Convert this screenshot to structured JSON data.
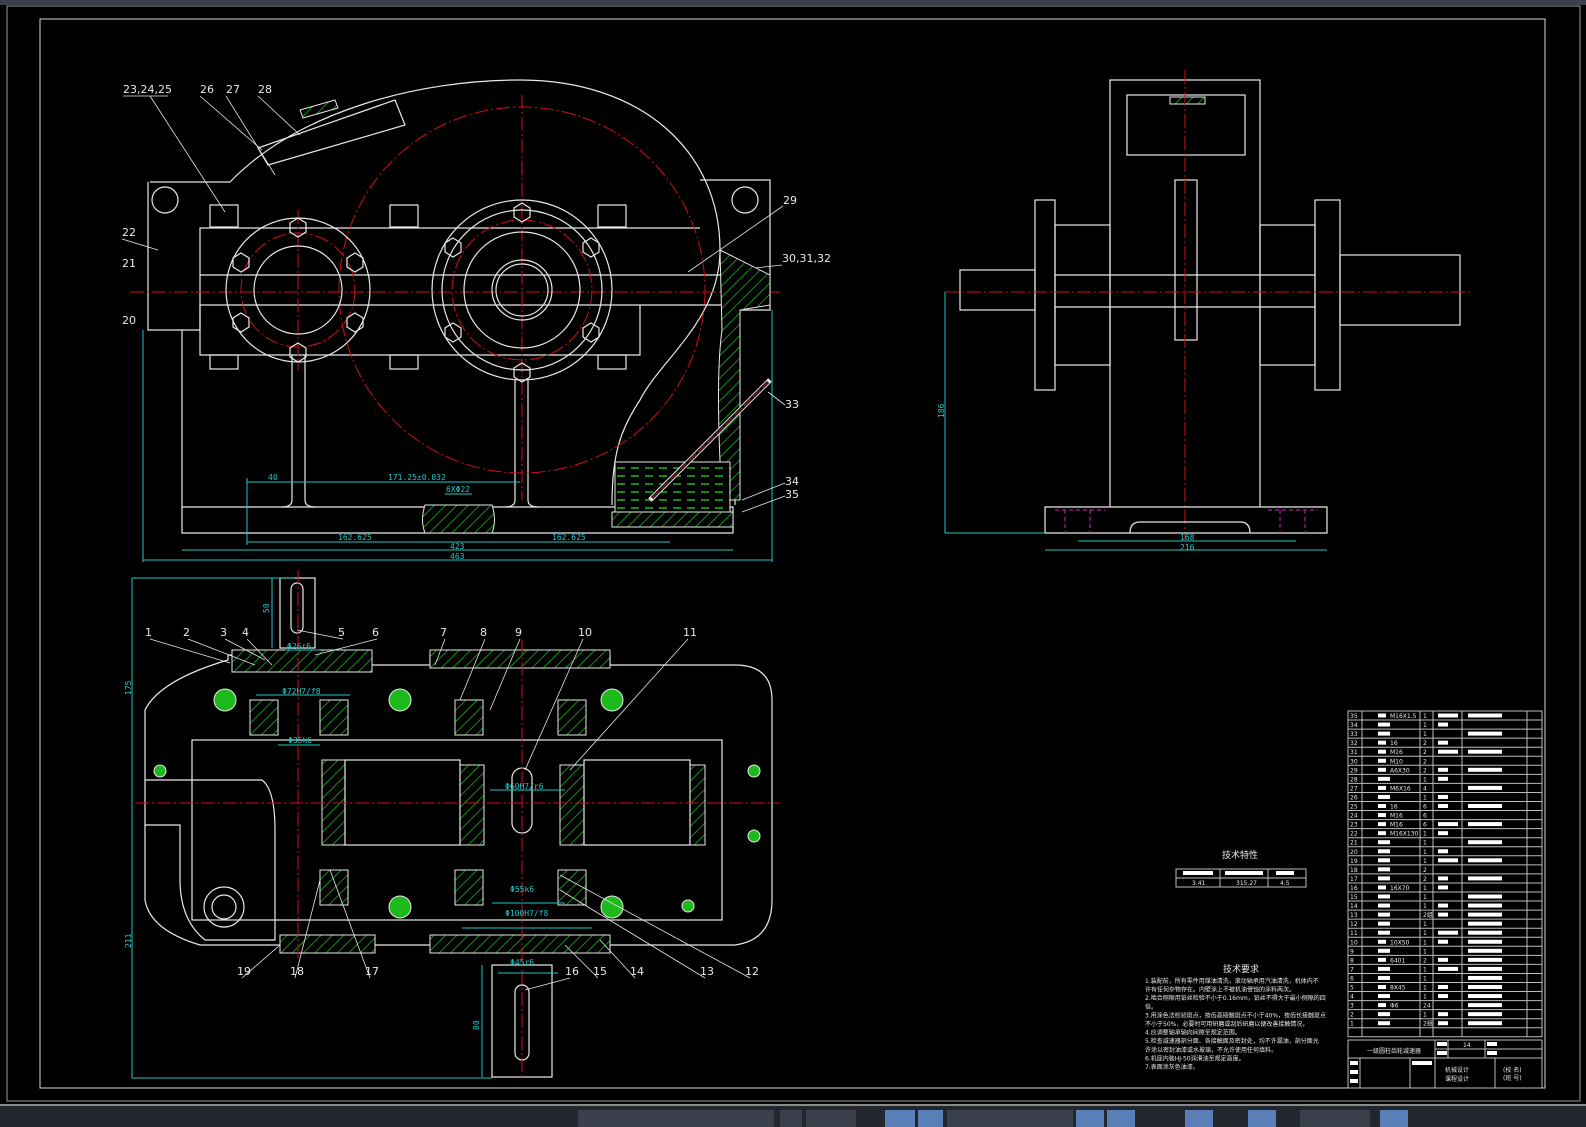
{
  "colors": {
    "background": "#000000",
    "outline": "#e8e8e8",
    "centerline": "#d01010",
    "dimension": "#1fc6c6",
    "hatch": "#1db91d",
    "hidden": "#d020d0"
  },
  "front_view": {
    "balloons": [
      "23,24,25",
      "26",
      "27",
      "28",
      "29",
      "30,31,32",
      "22",
      "21",
      "20",
      "33",
      "34",
      "35"
    ],
    "dims": {
      "d40": "40",
      "center_distance": "171.25±0.032",
      "bolt_holes": "6XΦ22",
      "half_left": "162.625",
      "half_right": "162.625",
      "inner_len": "423",
      "overall_len": "463"
    }
  },
  "side_view": {
    "dims": {
      "height": "186",
      "bolt_span": "168",
      "width": "216"
    }
  },
  "plan_view": {
    "balloons": [
      "1",
      "2",
      "3",
      "4",
      "5",
      "6",
      "7",
      "8",
      "9",
      "10",
      "11",
      "12",
      "13",
      "14",
      "15",
      "16",
      "17",
      "18",
      "19"
    ],
    "dims": {
      "key_len_in": "50",
      "shaft_in": "Φ26r6",
      "bore_in": "Φ72H7/f8",
      "bearing_in": "Φ35k6",
      "ext_top": "175",
      "gear_fit": "Φ60H7/r6",
      "bearing_out": "Φ55k6",
      "bore_out": "Φ100H7/f8",
      "shaft_out": "Φ45r6",
      "ext_bottom": "211",
      "key_len_out": "80"
    }
  },
  "tech_spec": {
    "title": "技术特性",
    "values": [
      "3.41",
      "315.27",
      "4.5"
    ]
  },
  "tech_req": {
    "title": "技术要求",
    "items": [
      "1.装配前，所有零件用煤油清洗，滚动轴承用汽油清洗，机体内不",
      "   许有任何杂物存在。内壁涂上不被机油侵蚀的涂料两次。",
      "2.啮合侧隙用铅丝检验不小于0.16mm，铅丝不得大于最小侧隙的四",
      "   倍。",
      "3.用涂色法检验斑点，按齿高接触斑点不小于40%，按齿长接触斑点",
      "   不小于50%，必要时可用研磨或刮后研磨以便改善接触情况。",
      "4.应调整轴承轴向间隙至规定范围。",
      "5.检查减速器剖分面、各接触面及密封处，均不许漏油，剖分面允",
      "   许涂以密封油漆或水玻璃，不允许使用任何填料。",
      "6.机座内装HJ-50润滑油至规定高度。",
      "7.表面涂灰色油漆。"
    ]
  },
  "bom": [
    {
      "no": "35",
      "spec": "M16X1.5",
      "qty": "1"
    },
    {
      "no": "34",
      "spec": "",
      "qty": "1"
    },
    {
      "no": "33",
      "spec": "",
      "qty": "1"
    },
    {
      "no": "32",
      "spec": "16",
      "qty": "2"
    },
    {
      "no": "31",
      "spec": "M16",
      "qty": "2"
    },
    {
      "no": "30",
      "spec": "M10",
      "qty": "2"
    },
    {
      "no": "29",
      "spec": "A6X30",
      "qty": "2"
    },
    {
      "no": "28",
      "spec": "",
      "qty": "1"
    },
    {
      "no": "27",
      "spec": "M6X16",
      "qty": "4"
    },
    {
      "no": "26",
      "spec": "",
      "qty": "1"
    },
    {
      "no": "25",
      "spec": "16",
      "qty": "6"
    },
    {
      "no": "24",
      "spec": "M16",
      "qty": "6"
    },
    {
      "no": "23",
      "spec": "M16",
      "qty": "6"
    },
    {
      "no": "22",
      "spec": "M16X130",
      "qty": "1"
    },
    {
      "no": "21",
      "spec": "",
      "qty": "1"
    },
    {
      "no": "20",
      "spec": "",
      "qty": "1"
    },
    {
      "no": "19",
      "spec": "",
      "qty": "1"
    },
    {
      "no": "18",
      "spec": "",
      "qty": "2"
    },
    {
      "no": "17",
      "spec": "",
      "qty": "2"
    },
    {
      "no": "16",
      "spec": "16X70",
      "qty": "1"
    },
    {
      "no": "15",
      "spec": "",
      "qty": "1"
    },
    {
      "no": "14",
      "spec": "",
      "qty": "1"
    },
    {
      "no": "13",
      "spec": "",
      "qty": "2组"
    },
    {
      "no": "12",
      "spec": "",
      "qty": "1"
    },
    {
      "no": "11",
      "spec": "",
      "qty": "1"
    },
    {
      "no": "10",
      "spec": "10X50",
      "qty": "1"
    },
    {
      "no": "9",
      "spec": "",
      "qty": "1"
    },
    {
      "no": "8",
      "spec": "6401",
      "qty": "2"
    },
    {
      "no": "7",
      "spec": "",
      "qty": "1"
    },
    {
      "no": "6",
      "spec": "",
      "qty": "1"
    },
    {
      "no": "5",
      "spec": "8X45",
      "qty": "1"
    },
    {
      "no": "4",
      "spec": "",
      "qty": "1"
    },
    {
      "no": "3",
      "spec": "Φ6",
      "qty": "24"
    },
    {
      "no": "2",
      "spec": "",
      "qty": "1"
    },
    {
      "no": "1",
      "spec": "",
      "qty": "2组"
    }
  ],
  "title_block": {
    "drawing_name": "一级圆柱齿轮减速器",
    "sheet": "14",
    "course": "机械设计",
    "course2": "课程设计",
    "school": "(校 名)",
    "class": "(班 号)"
  }
}
